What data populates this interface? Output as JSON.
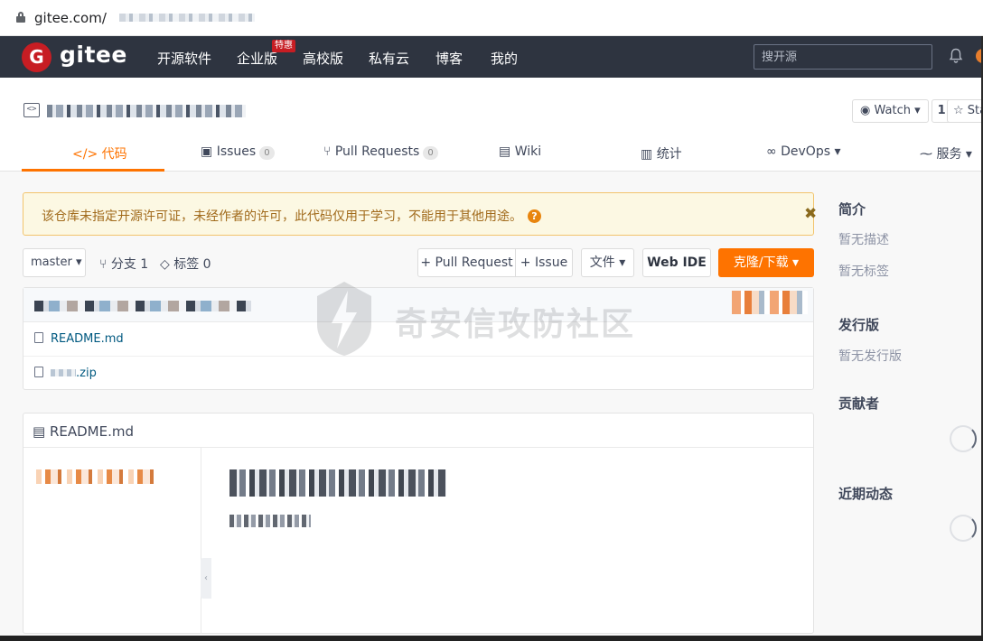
{
  "browser": {
    "url_visible": "gitee.com/"
  },
  "header": {
    "logo_letter": "G",
    "brand": "gitee",
    "nav": [
      "开源软件",
      "企业版",
      "高校版",
      "私有云",
      "博客",
      "我的"
    ],
    "badge": "特惠",
    "search_placeholder": "搜开源"
  },
  "repo": {
    "watch_label": "Watch ▾",
    "watch_count": "1",
    "star_label": "☆ Sta",
    "tabs": {
      "code": "代码",
      "issues": "Issues",
      "issues_count": "0",
      "pull_requests": "Pull Requests",
      "pull_requests_count": "0",
      "wiki": "Wiki",
      "stats": "统计",
      "devops": "DevOps",
      "service": "服务"
    }
  },
  "warning": {
    "text": "该仓库未指定开源许可证，未经作者的许可，此代码仅用于学习，不能用于其他用途。",
    "help": "?",
    "close": "✖"
  },
  "toolbar": {
    "branch": "master",
    "branches": "分支 1",
    "tags": "标签 0",
    "pull_request": "+ Pull Request",
    "issue": "+ Issue",
    "file": "文件",
    "web_ide": "Web IDE",
    "clone": "克隆/下载"
  },
  "files": [
    {
      "name": "README.md"
    },
    {
      "name": ".zip"
    }
  ],
  "readme": {
    "title": "README.md"
  },
  "sidebar": {
    "intro_title": "简介",
    "intro_desc": "暂无描述",
    "intro_tags": "暂无标签",
    "release_title": "发行版",
    "release_desc": "暂无发行版",
    "contrib_title": "贡献者",
    "activity_title": "近期动态"
  },
  "watermark": {
    "text": "奇安信攻防社区"
  },
  "colors": {
    "accent": "#fe7300",
    "header_bg": "#2e3440",
    "brand_red": "#c71d23",
    "warn_bg": "#fcf8e3"
  }
}
